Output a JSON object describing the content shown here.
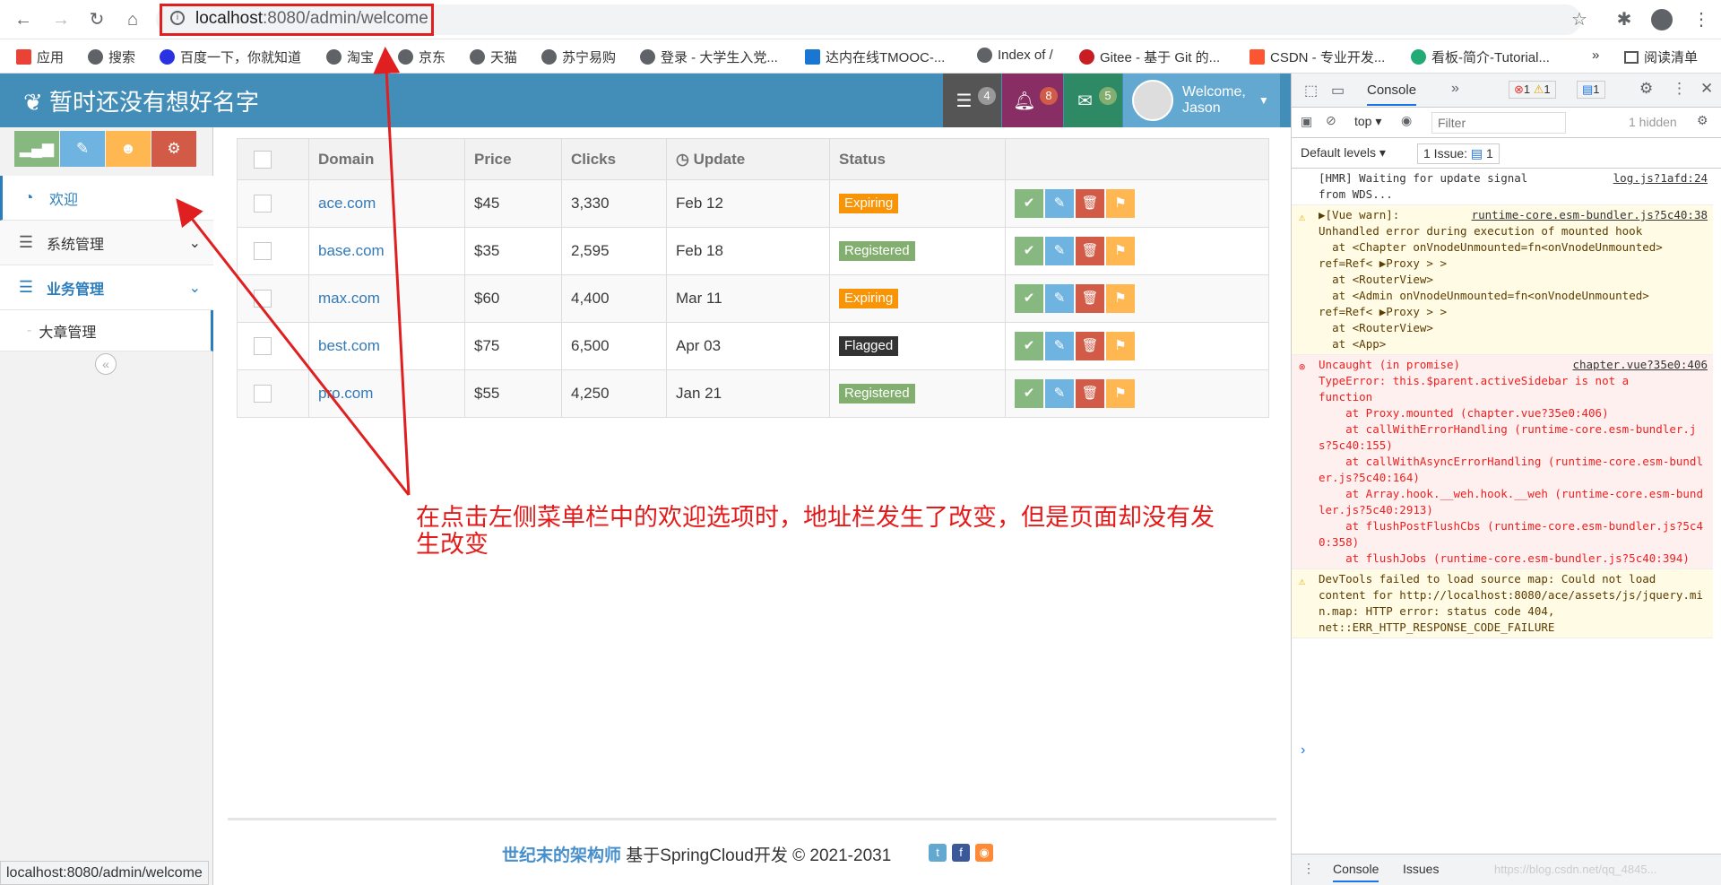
{
  "browser": {
    "url_host": "localhost",
    "url_rest": ":8080/admin/welcome",
    "bookmarks": [
      "应用",
      "搜索",
      "百度一下，你就知道",
      "淘宝",
      "京东",
      "天猫",
      "苏宁易购",
      "登录 - 大学生入党...",
      "达内在线TMOOC-...",
      "Index of /",
      "Gitee - 基于 Git 的...",
      "CSDN - 专业开发...",
      "看板-简介-Tutorial...",
      "»",
      "阅读清单"
    ],
    "status_url": "localhost:8080/admin/welcome"
  },
  "app": {
    "logo": "暂时还没有想好名字",
    "header": {
      "tasks_count": "4",
      "notifications_count": "8",
      "messages_count": "5",
      "welcome": "Welcome,",
      "user": "Jason"
    },
    "sidebar": {
      "items": [
        {
          "label": "欢迎",
          "icon": "tachometer-icon"
        },
        {
          "label": "系统管理",
          "icon": "list-icon"
        },
        {
          "label": "业务管理",
          "icon": "list-icon"
        },
        {
          "label": "大章管理",
          "icon": ""
        }
      ]
    },
    "table": {
      "headers": [
        "Domain",
        "Price",
        "Clicks",
        "Update",
        "Status"
      ],
      "rows": [
        {
          "domain": "ace.com",
          "price": "$45",
          "clicks": "3,330",
          "update": "Feb 12",
          "status": "Expiring",
          "status_color": "#f89406"
        },
        {
          "domain": "base.com",
          "price": "$35",
          "clicks": "2,595",
          "update": "Feb 18",
          "status": "Registered",
          "status_color": "#82af6f"
        },
        {
          "domain": "max.com",
          "price": "$60",
          "clicks": "4,400",
          "update": "Mar 11",
          "status": "Expiring",
          "status_color": "#f89406"
        },
        {
          "domain": "best.com",
          "price": "$75",
          "clicks": "6,500",
          "update": "Apr 03",
          "status": "Flagged",
          "status_color": "#333333"
        },
        {
          "domain": "pro.com",
          "price": "$55",
          "clicks": "4,250",
          "update": "Jan 21",
          "status": "Registered",
          "status_color": "#82af6f"
        }
      ]
    },
    "footer": {
      "brand": "世纪末的架构师",
      "text": "基于SpringCloud开发 © 2021-2031"
    }
  },
  "annotation": "在点击左侧菜单栏中的欢迎选项时，地址栏发生了改变，但是页面却没有发生改变",
  "devtools": {
    "tab_console": "Console",
    "errors": "1",
    "warnings": "1",
    "info": "1",
    "context": "top",
    "filter_placeholder": "Filter",
    "hidden": "1 hidden",
    "levels": "Default levels",
    "issue": "1 Issue:",
    "issue_count": "1",
    "messages": [
      {
        "type": "log",
        "text": "[HMR] Waiting for update signal\nfrom WDS...",
        "src": "log.js?1afd:24"
      },
      {
        "type": "warn",
        "text": "▶[Vue warn]:\nUnhandled error during execution of mounted hook\n  at <Chapter onVnodeUnmounted=fn<onVnodeUnmounted>\nref=Ref< ▶Proxy > >\n  at <RouterView>\n  at <Admin onVnodeUnmounted=fn<onVnodeUnmounted>\nref=Ref< ▶Proxy > >\n  at <RouterView>\n  at <App>",
        "src": "runtime-core.esm-bundler.js?5c40:38"
      },
      {
        "type": "err",
        "text": "Uncaught (in promise)\nTypeError: this.$parent.activeSidebar is not a\nfunction\n    at Proxy.mounted (chapter.vue?35e0:406)\n    at callWithErrorHandling (runtime-core.esm-bundler.js?5c40:155)\n    at callWithAsyncErrorHandling (runtime-core.esm-bundler.js?5c40:164)\n    at Array.hook.__weh.hook.__weh (runtime-core.esm-bundler.js?5c40:2913)\n    at flushPostFlushCbs (runtime-core.esm-bundler.js?5c40:358)\n    at flushJobs (runtime-core.esm-bundler.js?5c40:394)",
        "src": "chapter.vue?35e0:406"
      },
      {
        "type": "warn",
        "text": "DevTools failed to load source map: Could not load\ncontent for http://localhost:8080/ace/assets/js/jquery.min.map: HTTP error: status code 404,\nnet::ERR_HTTP_RESPONSE_CODE_FAILURE",
        "src": ""
      }
    ],
    "bottom_tabs": [
      "Console",
      "Issues"
    ],
    "watermark": "https://blog.csdn.net/qq_4845..."
  }
}
